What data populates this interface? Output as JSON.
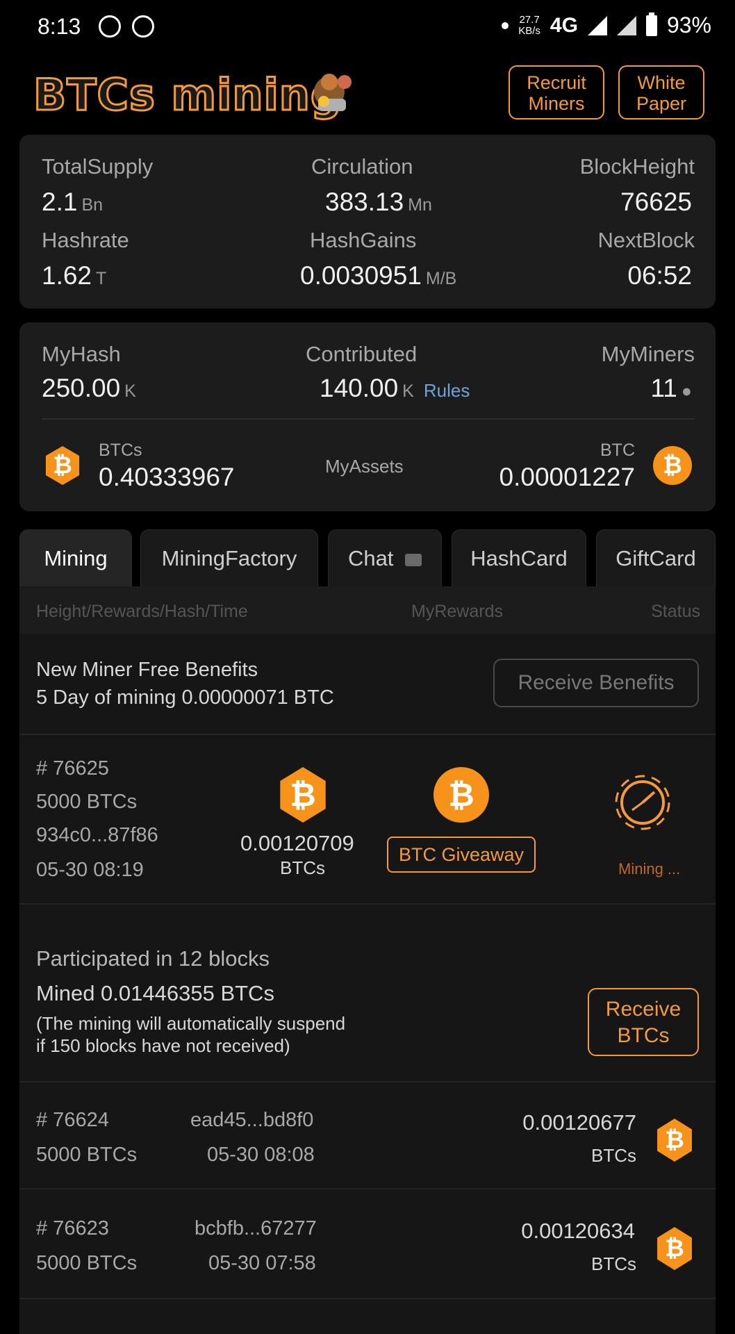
{
  "status_bar": {
    "time": "8:13",
    "speed_value": "27.7",
    "speed_unit": "KB/s",
    "network": "4G",
    "battery": "93%"
  },
  "header": {
    "logo_text": "BTCs mining",
    "recruit_line1": "Recruit",
    "recruit_line2": "Miners",
    "white_line1": "White",
    "white_line2": "Paper"
  },
  "stats": {
    "total_supply_label": "TotalSupply",
    "total_supply_value": "2.1",
    "total_supply_unit": "Bn",
    "circulation_label": "Circulation",
    "circulation_value": "383.13",
    "circulation_unit": "Mn",
    "block_height_label": "BlockHeight",
    "block_height_value": "76625",
    "hashrate_label": "Hashrate",
    "hashrate_value": "1.62",
    "hashrate_unit": "T",
    "hash_gains_label": "HashGains",
    "hash_gains_value": "0.0030951",
    "hash_gains_unit": "M/B",
    "next_block_label": "NextBlock",
    "next_block_value": "06:52"
  },
  "my": {
    "my_hash_label": "MyHash",
    "my_hash_value": "250.00",
    "my_hash_unit": "K",
    "contributed_label": "Contributed",
    "contributed_value": "140.00",
    "contributed_unit": "K",
    "rules_label": "Rules",
    "my_miners_label": "MyMiners",
    "my_miners_value": "11",
    "btcs_label": "BTCs",
    "btcs_value": "0.40333967",
    "assets_label": "MyAssets",
    "btc_label": "BTC",
    "btc_value": "0.00001227"
  },
  "tabs": [
    "Mining",
    "MiningFactory",
    "Chat",
    "HashCard",
    "GiftCard"
  ],
  "list_header": {
    "col1": "Height/Rewards/Hash/Time",
    "col2": "MyRewards",
    "col3": "Status"
  },
  "benefits": {
    "title": "New Miner Free Benefits",
    "desc": "5 Day of mining 0.00000071 BTC",
    "button": "Receive Benefits"
  },
  "current_block": {
    "height": "# 76625",
    "reward": "5000 BTCs",
    "hash": "934c0...87f86",
    "time": "05-30 08:19",
    "my_reward": "0.00120709",
    "my_reward_unit": "BTCs",
    "giveaway": "BTC Giveaway",
    "status": "Mining ..."
  },
  "participation": {
    "title": "Participated in 12 blocks",
    "mined": "Mined 0.01446355 BTCs",
    "note1": "(The mining will automatically suspend",
    "note2": "if 150 blocks have not received)",
    "button1": "Receive",
    "button2": "BTCs"
  },
  "blocks": [
    {
      "height": "# 76624",
      "hash": "ead45...bd8f0",
      "reward": "5000 BTCs",
      "time": "05-30 08:08",
      "amount": "0.00120677",
      "unit": "BTCs"
    },
    {
      "height": "# 76623",
      "hash": "bcbfb...67277",
      "reward": "5000 BTCs",
      "time": "05-30 07:58",
      "amount": "0.00120634",
      "unit": "BTCs"
    }
  ],
  "colors": {
    "accent": "#f39a3c",
    "bitcoin": "#f7931a",
    "background": "#000000",
    "card": "#1c1c1c"
  },
  "icons": {
    "btc": "₿",
    "chat": "chat-bubble",
    "person": "person"
  }
}
